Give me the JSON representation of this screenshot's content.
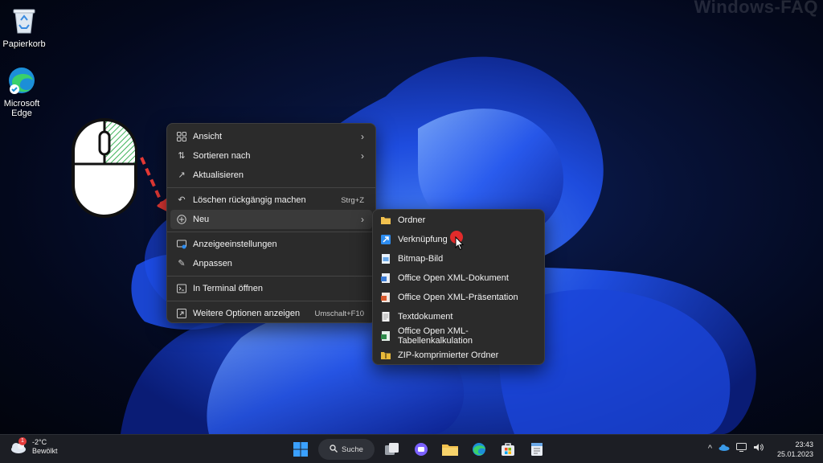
{
  "watermark": "Windows-FAQ",
  "desktop_icons": [
    {
      "label": "Papierkorb",
      "icon": "recycle-bin-icon"
    },
    {
      "label": "Microsoft Edge",
      "icon": "edge-icon"
    }
  ],
  "context_menu": {
    "items": [
      {
        "label": "Ansicht",
        "icon": "grid-icon",
        "submenu": true
      },
      {
        "label": "Sortieren nach",
        "icon": "sort-icon",
        "submenu": true
      },
      {
        "label": "Aktualisieren",
        "icon": "refresh-icon"
      },
      {
        "label": "Löschen rückgängig machen",
        "icon": "undo-icon",
        "shortcut": "Strg+Z"
      },
      {
        "label": "Neu",
        "icon": "plus-circle-icon",
        "submenu": true,
        "highlighted": true
      },
      {
        "label": "Anzeigeeinstellungen",
        "icon": "display-icon"
      },
      {
        "label": "Anpassen",
        "icon": "brush-icon"
      },
      {
        "label": "In Terminal öffnen",
        "icon": "terminal-icon"
      },
      {
        "label": "Weitere Optionen anzeigen",
        "icon": "more-options-icon",
        "shortcut": "Umschalt+F10"
      }
    ]
  },
  "new_submenu": {
    "items": [
      {
        "label": "Ordner",
        "icon": "folder-icon",
        "color": "#f2c14e"
      },
      {
        "label": "Verknüpfung",
        "icon": "shortcut-icon",
        "color": "#2d8cf0"
      },
      {
        "label": "Bitmap-Bild",
        "icon": "bitmap-icon",
        "color": "#9ac4f0"
      },
      {
        "label": "Office Open XML-Dokument",
        "icon": "word-doc-icon",
        "color": "#4a8fe0"
      },
      {
        "label": "Office Open XML-Präsentation",
        "icon": "powerpoint-icon",
        "color": "#e06a3a"
      },
      {
        "label": "Textdokument",
        "icon": "text-doc-icon",
        "color": "#e8e8e8"
      },
      {
        "label": "Office Open XML-Tabellenkalkulation",
        "icon": "excel-icon",
        "color": "#3fa45b"
      },
      {
        "label": "ZIP-komprimierter Ordner",
        "icon": "zip-folder-icon",
        "color": "#e8b93a"
      }
    ]
  },
  "taskbar": {
    "weather_temp": "-2°C",
    "weather_desc": "Bewölkt",
    "weather_badge": "1",
    "search_label": "Suche",
    "time": "23:43",
    "date": "25.01.2023"
  },
  "colors": {
    "accent": "#0a5cff",
    "menu_bg": "#2b2b2b",
    "taskbar_bg": "#1c1e24",
    "arrow": "#e53935"
  }
}
